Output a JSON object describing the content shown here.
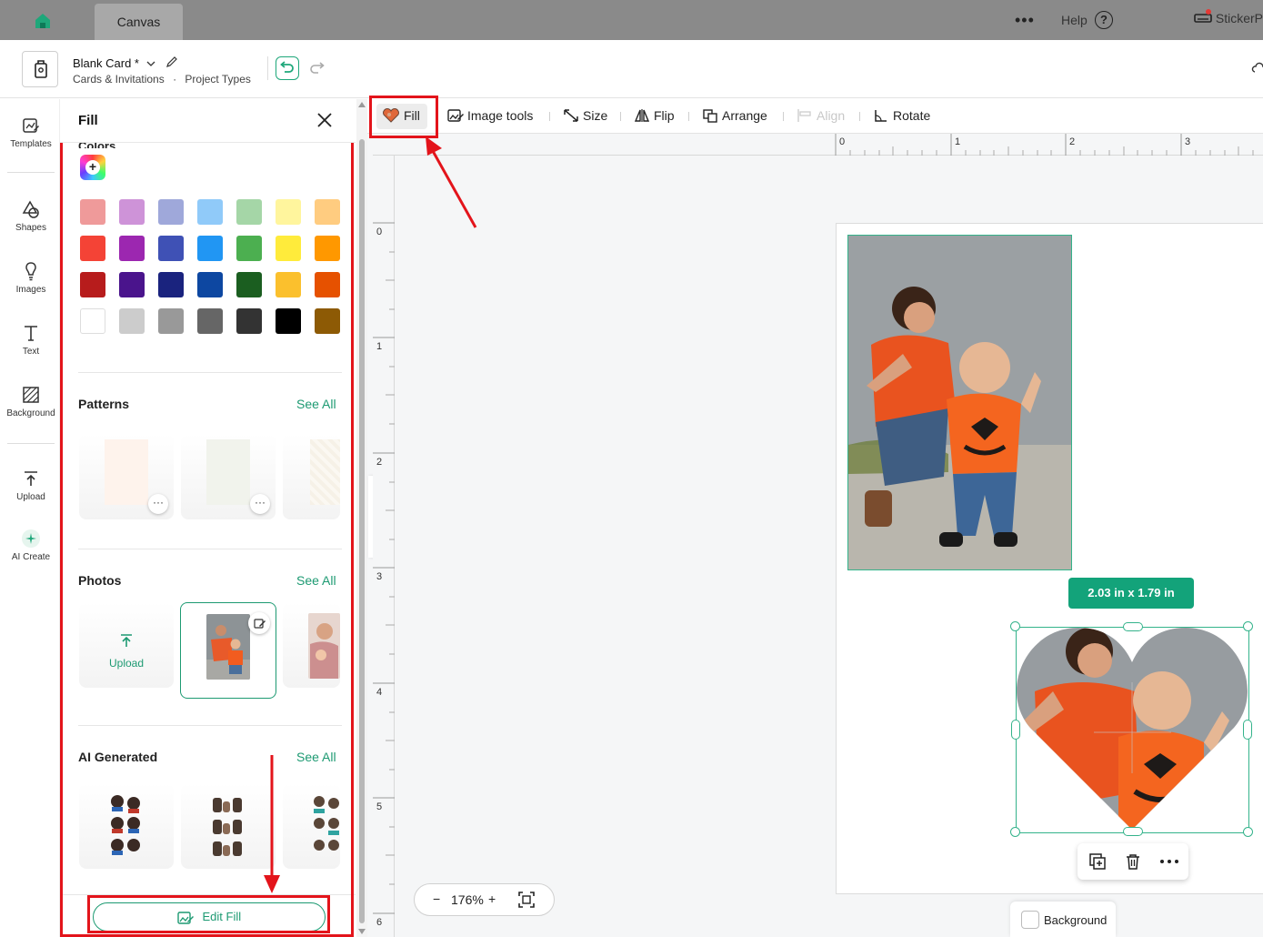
{
  "topbar": {
    "tab": "Canvas",
    "more": "•••",
    "help": "Help",
    "help_icon": "?",
    "sticker_label": "StickerP"
  },
  "project": {
    "title": "Blank Card *",
    "category": "Cards & Invitations",
    "separator": "·",
    "types": "Project Types"
  },
  "rail": {
    "items": [
      {
        "label": "Templates",
        "icon": "templates-icon"
      },
      {
        "label": "Shapes",
        "icon": "shapes-icon"
      },
      {
        "label": "Images",
        "icon": "images-icon"
      },
      {
        "label": "Text",
        "icon": "text-icon"
      },
      {
        "label": "Background",
        "icon": "background-icon"
      },
      {
        "label": "Upload",
        "icon": "upload-icon"
      },
      {
        "label": "AI Create",
        "icon": "sparkle-icon"
      }
    ]
  },
  "panel": {
    "title": "Fill",
    "colors_label": "Colors",
    "add_color": "+",
    "swatches": [
      [
        "#ef9a9a",
        "#ce93d8",
        "#9fa8da",
        "#90caf9",
        "#a5d6a7",
        "#fff59d",
        "#ffcc80"
      ],
      [
        "#f44336",
        "#9c27b0",
        "#3f51b5",
        "#2196f3",
        "#4caf50",
        "#ffeb3b",
        "#ff9800"
      ],
      [
        "#b71c1c",
        "#4a148c",
        "#1a237e",
        "#0d47a1",
        "#1b5e20",
        "#fbc02d",
        "#e65100"
      ],
      [
        "#ffffff",
        "#cccccc",
        "#999999",
        "#666666",
        "#333333",
        "#000000",
        "#8d5a05"
      ]
    ],
    "patterns": {
      "title": "Patterns",
      "see_all": "See All",
      "more": "···"
    },
    "photos": {
      "title": "Photos",
      "see_all": "See All",
      "upload": "Upload"
    },
    "ai": {
      "title": "AI Generated",
      "see_all": "See All"
    },
    "edit_fill": "Edit Fill"
  },
  "toolbar": {
    "fill": "Fill",
    "image_tools": "Image tools",
    "size": "Size",
    "flip": "Flip",
    "arrange": "Arrange",
    "align": "Align",
    "rotate": "Rotate"
  },
  "ruler": {
    "h": [
      "0",
      "1",
      "2",
      "3"
    ],
    "v": [
      "0",
      "1",
      "2",
      "3",
      "4",
      "5",
      "6"
    ]
  },
  "canvas": {
    "dimensions": "2.03  in x 1.79  in",
    "zoom": "176%",
    "zoom_minus": "−",
    "zoom_plus": "+",
    "background": "Background"
  },
  "colors": {
    "accent": "#13a37a",
    "annotation": "#e3141b"
  },
  "collapse_chevron": "‹"
}
